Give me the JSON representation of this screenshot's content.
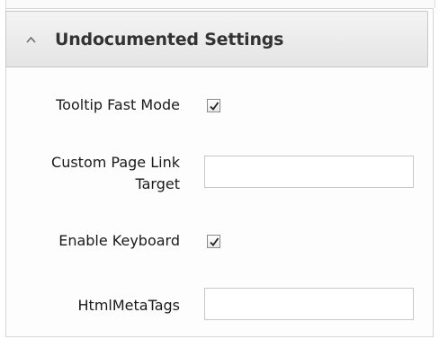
{
  "section": {
    "title": "Undocumented Settings",
    "collapse_icon": "chevron-up-icon"
  },
  "settings": [
    {
      "label": "Tooltip Fast Mode",
      "type": "checkbox",
      "checked": true
    },
    {
      "label_lines": [
        "Custom Page Link",
        "Target"
      ],
      "type": "text",
      "value": ""
    },
    {
      "label": "Enable Keyboard",
      "type": "checkbox",
      "checked": true
    },
    {
      "label": "HtmlMetaTags",
      "type": "text",
      "value": ""
    }
  ]
}
